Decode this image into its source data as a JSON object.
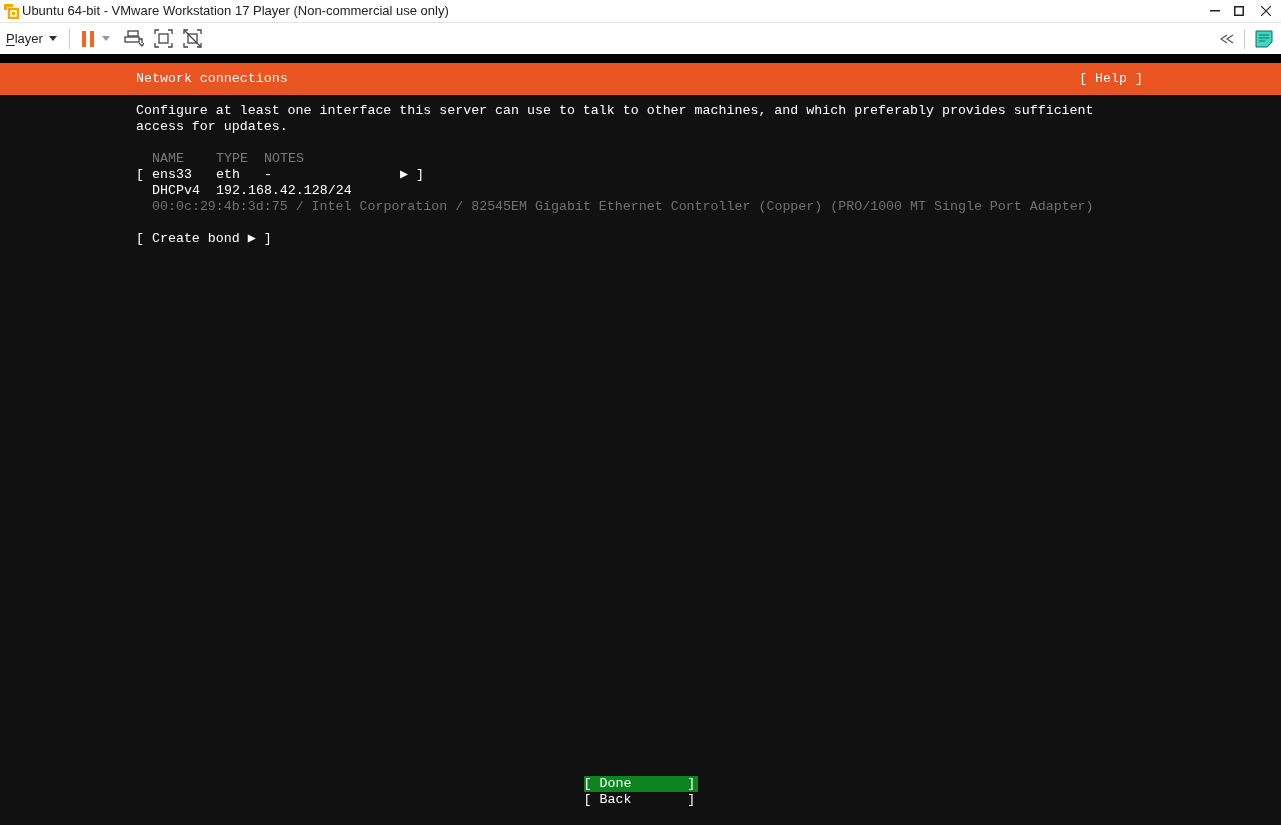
{
  "window": {
    "title": "Ubuntu 64-bit - VMware Workstation 17 Player (Non-commercial use only)"
  },
  "toolbar": {
    "menu": "Player",
    "paused": true
  },
  "header": {
    "title": "Network connections",
    "help": "[ Help ]"
  },
  "intro": "Configure at least one interface this server can use to talk to other machines, and which preferably provides sufficient access for updates.",
  "table": {
    "columns": [
      "NAME",
      "TYPE",
      "NOTES"
    ],
    "rows": [
      {
        "open": "[",
        "name": "ens33",
        "type": "eth",
        "notes": "-",
        "arrow": "▶",
        "close": "]",
        "selected": false,
        "address_kind": "DHCPv4",
        "address": "192.168.42.128/24",
        "details": "00:0c:29:4b:3d:75 / Intel Corporation / 82545EM Gigabit Ethernet Controller (Copper) (PRO/1000 MT Single Port Adapter)"
      }
    ]
  },
  "create_bond": "[ Create bond ▶ ]",
  "buttons": [
    {
      "label": "[ Done       ]",
      "selected": true
    },
    {
      "label": "[ Back       ]",
      "selected": false
    }
  ]
}
